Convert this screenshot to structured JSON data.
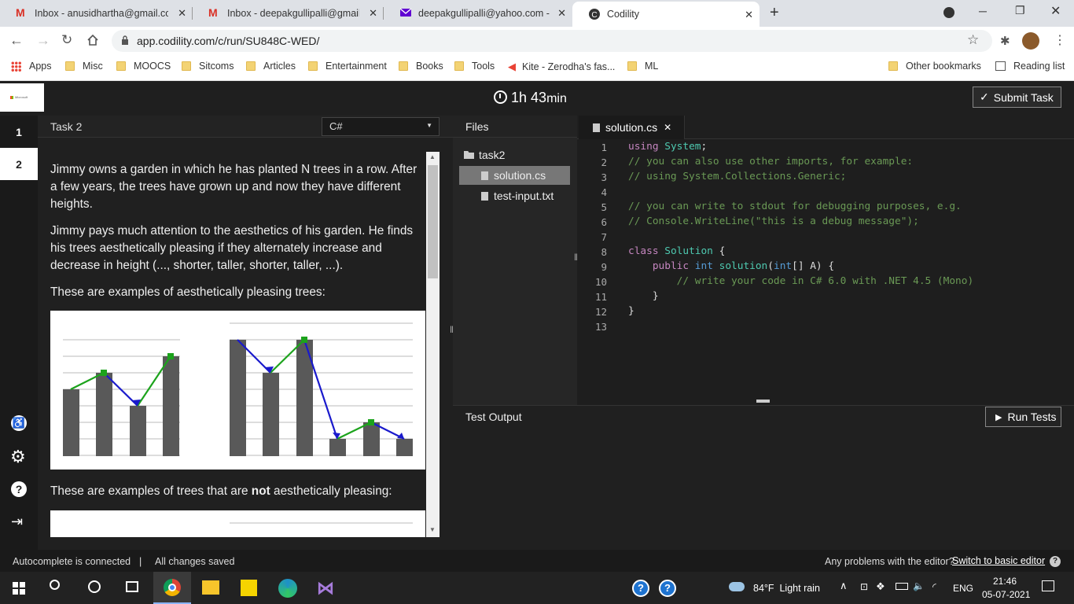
{
  "browser": {
    "tabs": [
      {
        "title": "Inbox - anusidhartha@gmail.com",
        "icon": "gmail-icon"
      },
      {
        "title": "Inbox - deepakgullipalli@gmail.c",
        "icon": "gmail-icon"
      },
      {
        "title": "deepakgullipalli@yahoo.com - Ya",
        "icon": "yahoo-mail-icon"
      },
      {
        "title": "Codility",
        "icon": "codility-icon"
      }
    ],
    "url": "app.codility.com/c/run/SU848C-WED/",
    "bookmarks": [
      "Apps",
      "Misc",
      "MOOCS",
      "Sitcoms",
      "Articles",
      "Entertainment",
      "Books",
      "Tools",
      "Kite - Zerodha's fas...",
      "ML"
    ],
    "other_bookmarks": "Other bookmarks",
    "reading_list": "Reading list"
  },
  "header": {
    "logo_text": "Microsoft",
    "timer_hours": "1h",
    "timer_minutes": "43",
    "timer_unit": "min",
    "submit_label": "Submit Task"
  },
  "rail": {
    "task_numbers": [
      "1",
      "2"
    ]
  },
  "task": {
    "title": "Task 2",
    "language": "C#",
    "paragraph1": "Jimmy owns a garden in which he has planted N trees in a row. After a few years, the trees have grown up and now they have different heights.",
    "paragraph2": "Jimmy pays much attention to the aesthetics of his garden. He finds his trees aesthetically pleasing if they alternately increase and decrease in height (..., shorter, taller, shorter, taller, ...).",
    "paragraph3": "These are examples of aesthetically pleasing trees:",
    "paragraph4_pre": "These are examples of trees that are ",
    "paragraph4_bold": "not",
    "paragraph4_post": " aesthetically pleasing:"
  },
  "files": {
    "header": "Files",
    "folder": "task2",
    "items": [
      "solution.cs",
      "test-input.txt"
    ]
  },
  "editor": {
    "tab_label": "solution.cs",
    "line_numbers": [
      "1",
      "2",
      "3",
      "4",
      "5",
      "6",
      "7",
      "8",
      "9",
      "10",
      "11",
      "12",
      "13"
    ],
    "lines": [
      "using System;",
      "// you can also use other imports, for example:",
      "// using System.Collections.Generic;",
      "",
      "// you can write to stdout for debugging purposes, e.g.",
      "// Console.WriteLine(\"this is a debug message\");",
      "",
      "class Solution {",
      "    public int solution(int[] A) {",
      "        // write your code in C# 6.0 with .NET 4.5 (Mono)",
      "    }",
      "}",
      ""
    ]
  },
  "output": {
    "title": "Test Output",
    "run_label": "Run Tests"
  },
  "status": {
    "autocomplete": "Autocomplete is connected",
    "separator": "|",
    "saved": "All changes saved",
    "problems": "Any problems with the editor?",
    "switch_link": "Switch to basic editor"
  },
  "taskbar": {
    "weather": "84°F  Light rain",
    "language": "ENG",
    "time": "21:46",
    "date": "05-07-2021"
  },
  "colors": {
    "accent_green": "#1ca31c",
    "accent_blue": "#1a1acc",
    "bar_grey": "#595959"
  }
}
